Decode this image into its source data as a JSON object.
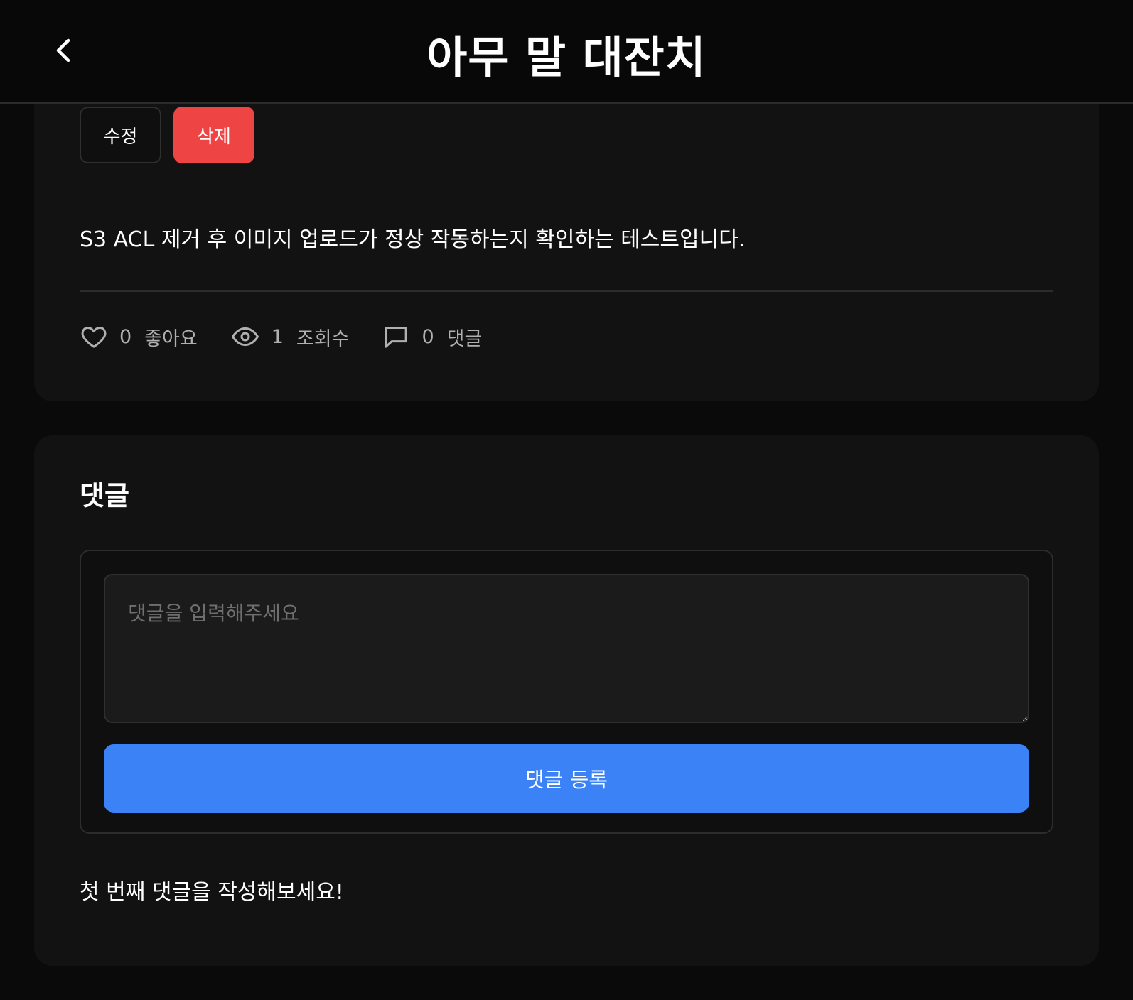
{
  "header": {
    "title": "아무 말 대잔치",
    "back_icon": "chevron-left-icon"
  },
  "post": {
    "actions": {
      "edit_label": "수정",
      "delete_label": "삭제"
    },
    "content": "S3 ACL 제거 후 이미지 업로드가 정상 작동하는지 확인하는 테스트입니다.",
    "stats": {
      "likes": {
        "icon": "heart-icon",
        "count": "0",
        "label": "좋아요"
      },
      "views": {
        "icon": "eye-icon",
        "count": "1",
        "label": "조회수"
      },
      "comments": {
        "icon": "comment-icon",
        "count": "0",
        "label": "댓글"
      }
    }
  },
  "comments": {
    "title": "댓글",
    "input_placeholder": "댓글을 입력해주세요",
    "submit_label": "댓글 등록",
    "empty_message": "첫 번째 댓글을 작성해보세요!"
  },
  "colors": {
    "background": "#0a0a0a",
    "card": "#121212",
    "delete": "#ef4444",
    "primary": "#3b82f6",
    "muted_text": "#b0b0b0"
  }
}
